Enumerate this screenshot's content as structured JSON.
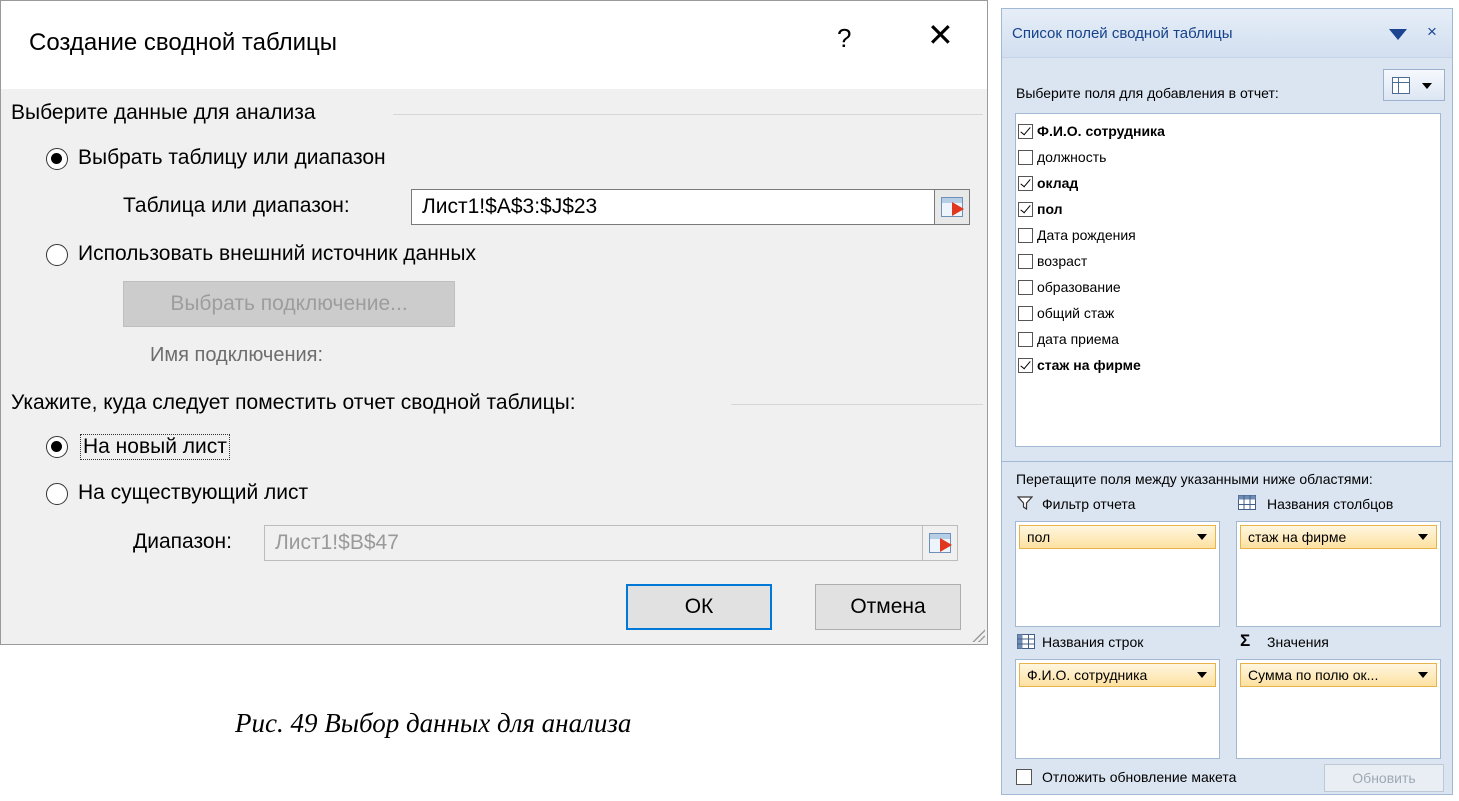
{
  "dialog": {
    "title": "Создание сводной таблицы",
    "help_glyph": "?",
    "close_glyph": "✕",
    "section1_label": "Выберите данные для анализа",
    "opt_table_label": "Выбрать таблицу или диапазон",
    "table_range_label": "Таблица или диапазон:",
    "table_range_value": "Лист1!$A$3:$J$23",
    "opt_external_label": "Использовать внешний источник данных",
    "choose_connection_label": "Выбрать подключение...",
    "connection_name_label": "Имя подключения:",
    "section2_label": "Укажите, куда следует поместить отчет сводной таблицы:",
    "opt_new_sheet_label": "На новый лист",
    "opt_existing_sheet_label": "На существующий лист",
    "range_label": "Диапазон:",
    "range_value": "Лист1!$B$47",
    "ok_label": "ОК",
    "cancel_label": "Отмена",
    "selected_source": "table",
    "selected_destination": "new_sheet"
  },
  "caption": "Рис. 49 Выбор данных для анализа",
  "field_list": {
    "title": "Список полей сводной таблицы",
    "close_glyph": "×",
    "choose_fields_label": "Выберите поля для добавления в отчет:",
    "fields": [
      {
        "label": "Ф.И.О. сотрудника",
        "checked": true
      },
      {
        "label": "должность",
        "checked": false
      },
      {
        "label": "оклад",
        "checked": true
      },
      {
        "label": "пол",
        "checked": true
      },
      {
        "label": "Дата рождения",
        "checked": false
      },
      {
        "label": "возраст",
        "checked": false
      },
      {
        "label": "образование",
        "checked": false
      },
      {
        "label": "общий стаж",
        "checked": false
      },
      {
        "label": "дата приема",
        "checked": false
      },
      {
        "label": "стаж на фирме",
        "checked": true
      }
    ],
    "drag_hint": "Перетащите поля между указанными ниже областями:",
    "areas": {
      "filter": {
        "header": "Фильтр отчета",
        "items": [
          "пол"
        ]
      },
      "columns": {
        "header": "Названия столбцов",
        "items": [
          "стаж на фирме"
        ]
      },
      "rows": {
        "header": "Названия строк",
        "items": [
          "Ф.И.О. сотрудника"
        ]
      },
      "values": {
        "header": "Значения",
        "items": [
          "Сумма по полю ок..."
        ],
        "sigma": "Σ"
      }
    },
    "defer_label": "Отложить обновление макета",
    "defer_checked": false,
    "update_label": "Обновить"
  }
}
